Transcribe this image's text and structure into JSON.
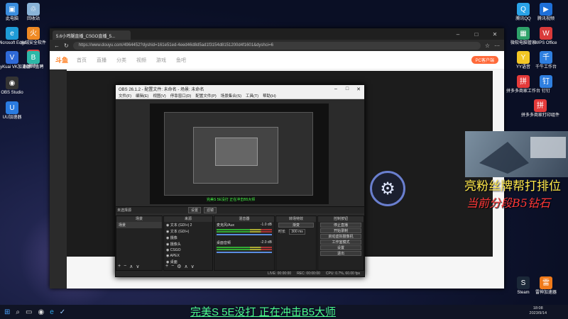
{
  "desktop_left": [
    {
      "label": "此电脑",
      "color": "#3a8dde",
      "glyph": "▣"
    },
    {
      "label": "回收站",
      "color": "#8ab4d8",
      "glyph": "♲"
    },
    {
      "label": "Microsoft Edge",
      "color": "#1e9bd7",
      "glyph": "e"
    },
    {
      "label": "火绒安全软件",
      "color": "#f08a24",
      "glyph": "火"
    },
    {
      "label": "猎豹",
      "color": "#d94444",
      "glyph": "◆"
    },
    {
      "label": "VeryKuai VK加速器",
      "color": "#2f6ad8",
      "glyph": "V"
    },
    {
      "label": "BOSS直聘",
      "color": "#2db8a8",
      "glyph": "B"
    },
    {
      "label": "OBS Studio",
      "color": "#333",
      "glyph": "◉"
    },
    {
      "label": "UU加速器",
      "color": "#2a7be0",
      "glyph": "U"
    }
  ],
  "desktop_right": [
    {
      "label": "腾讯QQ",
      "color": "#2aa3e8",
      "glyph": "Q"
    },
    {
      "label": "腾讯视频",
      "color": "#1e6fd8",
      "glyph": "▶"
    },
    {
      "label": "微软电脑管家",
      "color": "#2fa26a",
      "glyph": "▦"
    },
    {
      "label": "WPS Office",
      "color": "#d93a3a",
      "glyph": "W"
    },
    {
      "label": "YY语音",
      "color": "#f3c625",
      "glyph": "Y"
    },
    {
      "label": "千牛工作台",
      "color": "#2f7fe0",
      "glyph": "千"
    },
    {
      "label": "拼多多商家工作台",
      "color": "#e43a3a",
      "glyph": "拼"
    },
    {
      "label": "钉钉",
      "color": "#2f7fe0",
      "glyph": "钉"
    },
    {
      "label": "拼多多商家打印组件",
      "color": "#e43a3a",
      "glyph": "拼"
    },
    {
      "label": "Steam",
      "color": "#1b2838",
      "glyph": "S"
    },
    {
      "label": "雷神加速器",
      "color": "#f07a1a",
      "glyph": "雷"
    }
  ],
  "browser": {
    "tab_title": "5.6小鸡腿直播_CSGO直播_5...",
    "url": "https://www.douyu.com/4964452?dyshid=161e51ed-4eed46d8d5ad1f3154d8151200d4f1601&dyshci=6",
    "site_nav": [
      "首页",
      "直播",
      "分类",
      "视频",
      "游戏",
      "鱼吧"
    ],
    "site_logo": "斗鱼",
    "upload_btn": "PC客户端"
  },
  "obs": {
    "title": "OBS 26.1.2 - 配置文件: 未命名 - 场景: 未命名",
    "menu": [
      "文件(F)",
      "编辑(E)",
      "视图(V)",
      "停靠窗口(D)",
      "配置文件(P)",
      "场景集合(S)",
      "工具(T)",
      "帮助(H)"
    ],
    "preview_caption": "完美S 5E没打 正在冲击B5大师",
    "mode_label": "未选择源",
    "mode_buttons": [
      "设置",
      "滤镜"
    ],
    "scenes_header": "场景",
    "scenes": [
      "场景"
    ],
    "sources_header": "来源",
    "sources": [
      "文本 (GDI+) 2",
      "文本 (GDI+)",
      "摄像",
      "摄像头",
      "CSGO",
      "APEX",
      "桌面"
    ],
    "mixer_header": "混音器",
    "mixer": [
      {
        "name": "麦克风/Aux",
        "db": "-1.0 dB"
      },
      {
        "name": "桌面音频",
        "db": "-2.0 dB"
      }
    ],
    "transition_header": "转场特效",
    "transition": {
      "type": "渐变",
      "duration_label": "时长",
      "duration": "300 ms"
    },
    "controls_header": "控制按钮",
    "controls": [
      "停止直播",
      "开始录制",
      "启动虚拟摄像机",
      "工作室模式",
      "设置",
      "退出"
    ],
    "status": {
      "live": "LIVE: 00:00:00",
      "rec": "REC: 00:00:00",
      "cpu": "CPU: 0.7%, 60.00 fps"
    }
  },
  "overlay": {
    "line1": "亮粉丝牌帮打排位",
    "line2": "当前分段B5钻石",
    "subtitle": "完美S 5E没打 正在冲击B5大师"
  },
  "taskbar": {
    "time": "18:08",
    "date": "2023/9/14"
  }
}
